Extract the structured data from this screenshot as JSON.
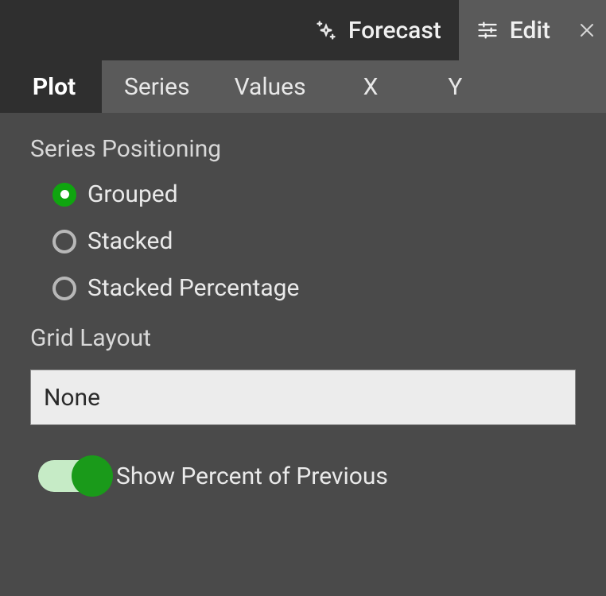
{
  "topbar": {
    "forecast_label": "Forecast",
    "edit_label": "Edit"
  },
  "tabs": {
    "plot": "Plot",
    "series": "Series",
    "values": "Values",
    "x": "X",
    "y": "Y"
  },
  "panel": {
    "series_positioning_heading": "Series Positioning",
    "radios": {
      "grouped": "Grouped",
      "stacked": "Stacked",
      "stacked_pct": "Stacked Percentage"
    },
    "grid_layout_heading": "Grid Layout",
    "grid_layout_value": "None",
    "toggle_show_pct_prev": "Show Percent of Previous"
  }
}
